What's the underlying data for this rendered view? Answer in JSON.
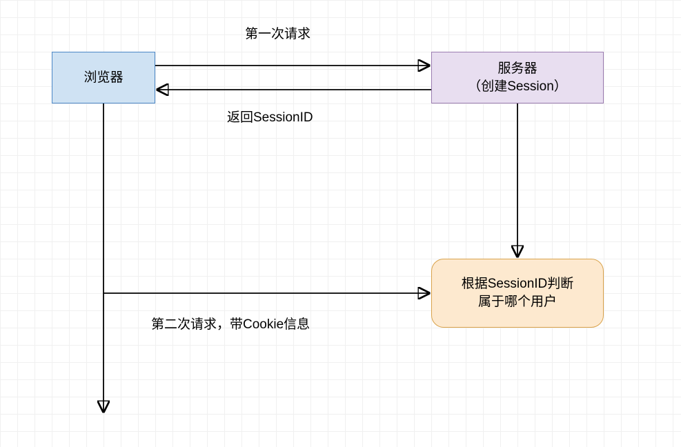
{
  "nodes": {
    "browser": "浏览器",
    "server": "服务器\n（创建Session）",
    "judge": "根据SessionID判断\n属于哪个用户"
  },
  "edges": {
    "first_request": "第一次请求",
    "return_session": "返回SessionID",
    "second_request": "第二次请求，带Cookie信息"
  }
}
